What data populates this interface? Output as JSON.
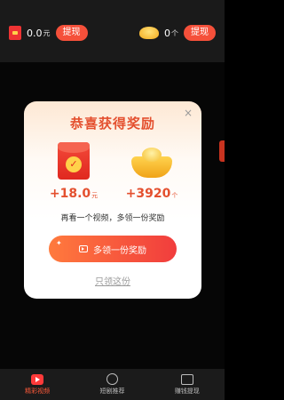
{
  "header": {
    "cash_amount": "0.0",
    "cash_unit": "元",
    "cash_withdraw_label": "提现",
    "coin_count": "0",
    "coin_unit": "个",
    "coin_withdraw_label": "提现"
  },
  "modal": {
    "close_symbol": "×",
    "title": "恭喜获得奖励",
    "cash_reward": "+18.0",
    "cash_reward_unit": "元",
    "coin_reward": "+3920",
    "coin_reward_unit": "个",
    "hint": "再看一个视频，多领一份奖励",
    "cta_label": "多领一份奖励",
    "secondary_link": "只领这份"
  },
  "bottom_nav": {
    "items": [
      {
        "label": "精彩视频"
      },
      {
        "label": "短剧推荐"
      },
      {
        "label": "赚钱提现"
      }
    ]
  },
  "colors": {
    "accent": "#e4502f",
    "cta_start": "#ff7a3d",
    "cta_end": "#f13d3d"
  },
  "icons": [
    "red-envelope-icon",
    "gold-ingot-icon",
    "video-icon",
    "film-reel-icon",
    "wallet-icon",
    "close-icon"
  ]
}
